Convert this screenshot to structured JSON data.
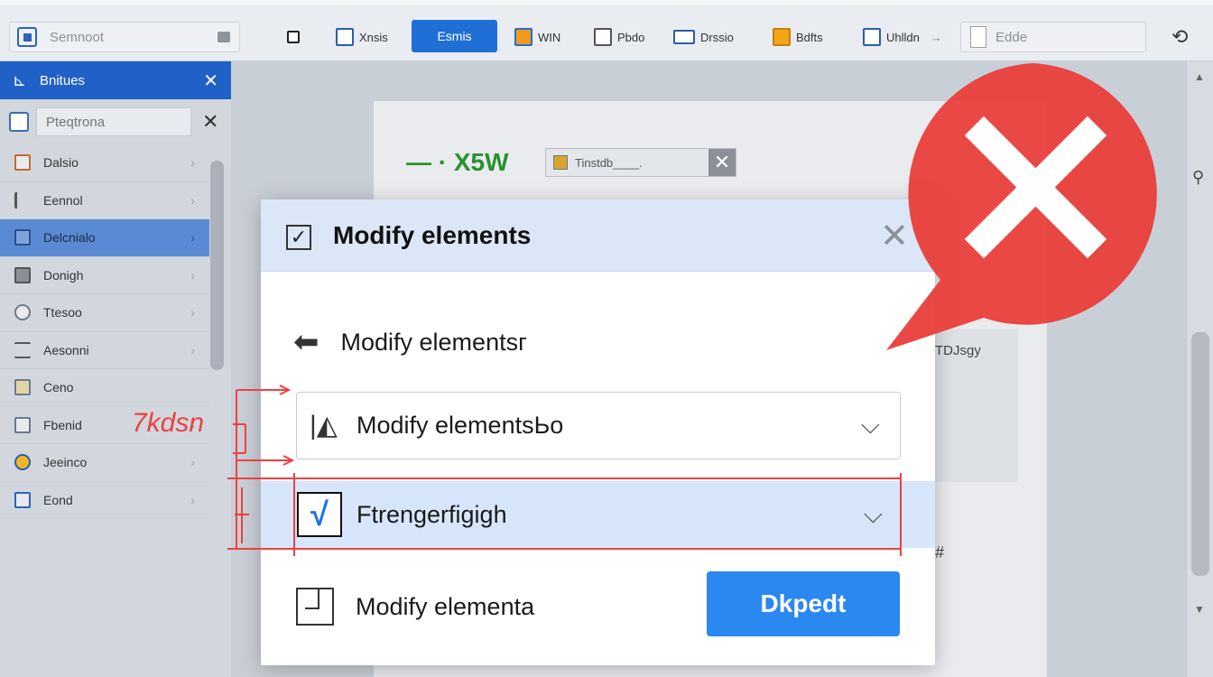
{
  "toolbar": {
    "search_text": "Semnoot",
    "items": [
      {
        "label": ""
      },
      {
        "label": "Xnsis"
      },
      {
        "label": "Esmis"
      },
      {
        "label": "WIN"
      },
      {
        "label": "Pbdo"
      },
      {
        "label": "Drssio"
      },
      {
        "label": "Bdfts"
      },
      {
        "label": "Uhlldn"
      }
    ],
    "url_text": "Edde"
  },
  "sidebar": {
    "title": "Bnitues",
    "search_placeholder": "Pteqtrona",
    "items": [
      {
        "label": "Dalsio"
      },
      {
        "label": "Eennol"
      },
      {
        "label": "Delcnialo"
      },
      {
        "label": "Donigh"
      },
      {
        "label": "Ttesoo"
      },
      {
        "label": "Aesonni"
      },
      {
        "label": "Ceno"
      },
      {
        "label": "Fbenid"
      },
      {
        "label": "Jeeinco"
      },
      {
        "label": "Eond"
      }
    ]
  },
  "document": {
    "heading": "— · X5W",
    "input_text": "Tinstdb____.",
    "side_text": "TDJsgy",
    "mark_text": "#"
  },
  "modal": {
    "title": "Modify elements",
    "back_label": "Modify elementsг",
    "select1_label": "Modify elementsЬo",
    "select2_label": "Ftrengerfigigh",
    "last_label": "Modify elementa",
    "primary_button": "Dkpedt"
  },
  "annotation": {
    "label": "7kdsn"
  },
  "colors": {
    "accent": "#1f6fd6",
    "sidebar_header": "#1f61c7",
    "error": "#e8413c",
    "annotation": "#ee4040",
    "primary_button": "#2a88f0"
  }
}
